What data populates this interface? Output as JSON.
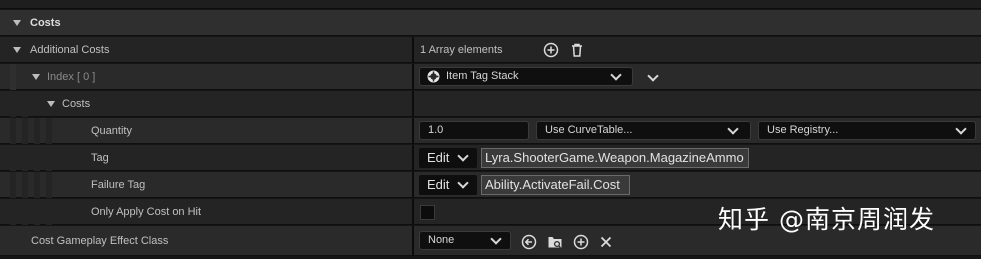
{
  "sections": {
    "costs_header": "Costs",
    "additional_costs": "Additional Costs",
    "array_count": "1 Array elements",
    "index_label": "Index [ 0 ]",
    "struct_type": "Item Tag Stack",
    "costs_sub": "Costs"
  },
  "fields": {
    "quantity_label": "Quantity",
    "quantity_value": "1.0",
    "curve_table": "Use CurveTable...",
    "registry": "Use Registry...",
    "tag_label": "Tag",
    "tag_edit": "Edit",
    "tag_value": "Lyra.ShooterGame.Weapon.MagazineAmmo",
    "failure_tag_label": "Failure Tag",
    "failure_edit": "Edit",
    "failure_tag_value": "Ability.ActivateFail.Cost",
    "only_apply_label": "Only Apply Cost on Hit",
    "only_apply_checked": false,
    "effect_class_label": "Cost Gameplay Effect Class",
    "effect_class_value": "None"
  },
  "icons": {
    "add": "add-circle-icon",
    "delete": "trash-icon",
    "browse_back": "back-arrow-icon",
    "folder": "browse-folder-icon",
    "clear": "close-icon"
  },
  "watermark": "知乎 @南京周润发"
}
